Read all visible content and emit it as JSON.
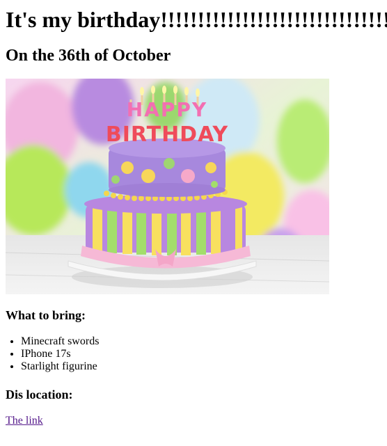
{
  "page": {
    "title": "It's my birthday!!!!!!!!!!!!!!!!!!!!!!!!!!!!!!!!",
    "subtitle": "On the 36th of October"
  },
  "hero_image": {
    "banner_top": "HAPPY",
    "banner_bottom": "BIRTHDAY"
  },
  "bring": {
    "heading": "What to bring:",
    "items": [
      "Minecraft swords",
      "IPhone 17s",
      "Starlight figurine"
    ]
  },
  "location": {
    "heading": "Dis location:",
    "link_text": "The link"
  },
  "colors": {
    "link_visited": "#551a8b",
    "text": "#000000"
  }
}
